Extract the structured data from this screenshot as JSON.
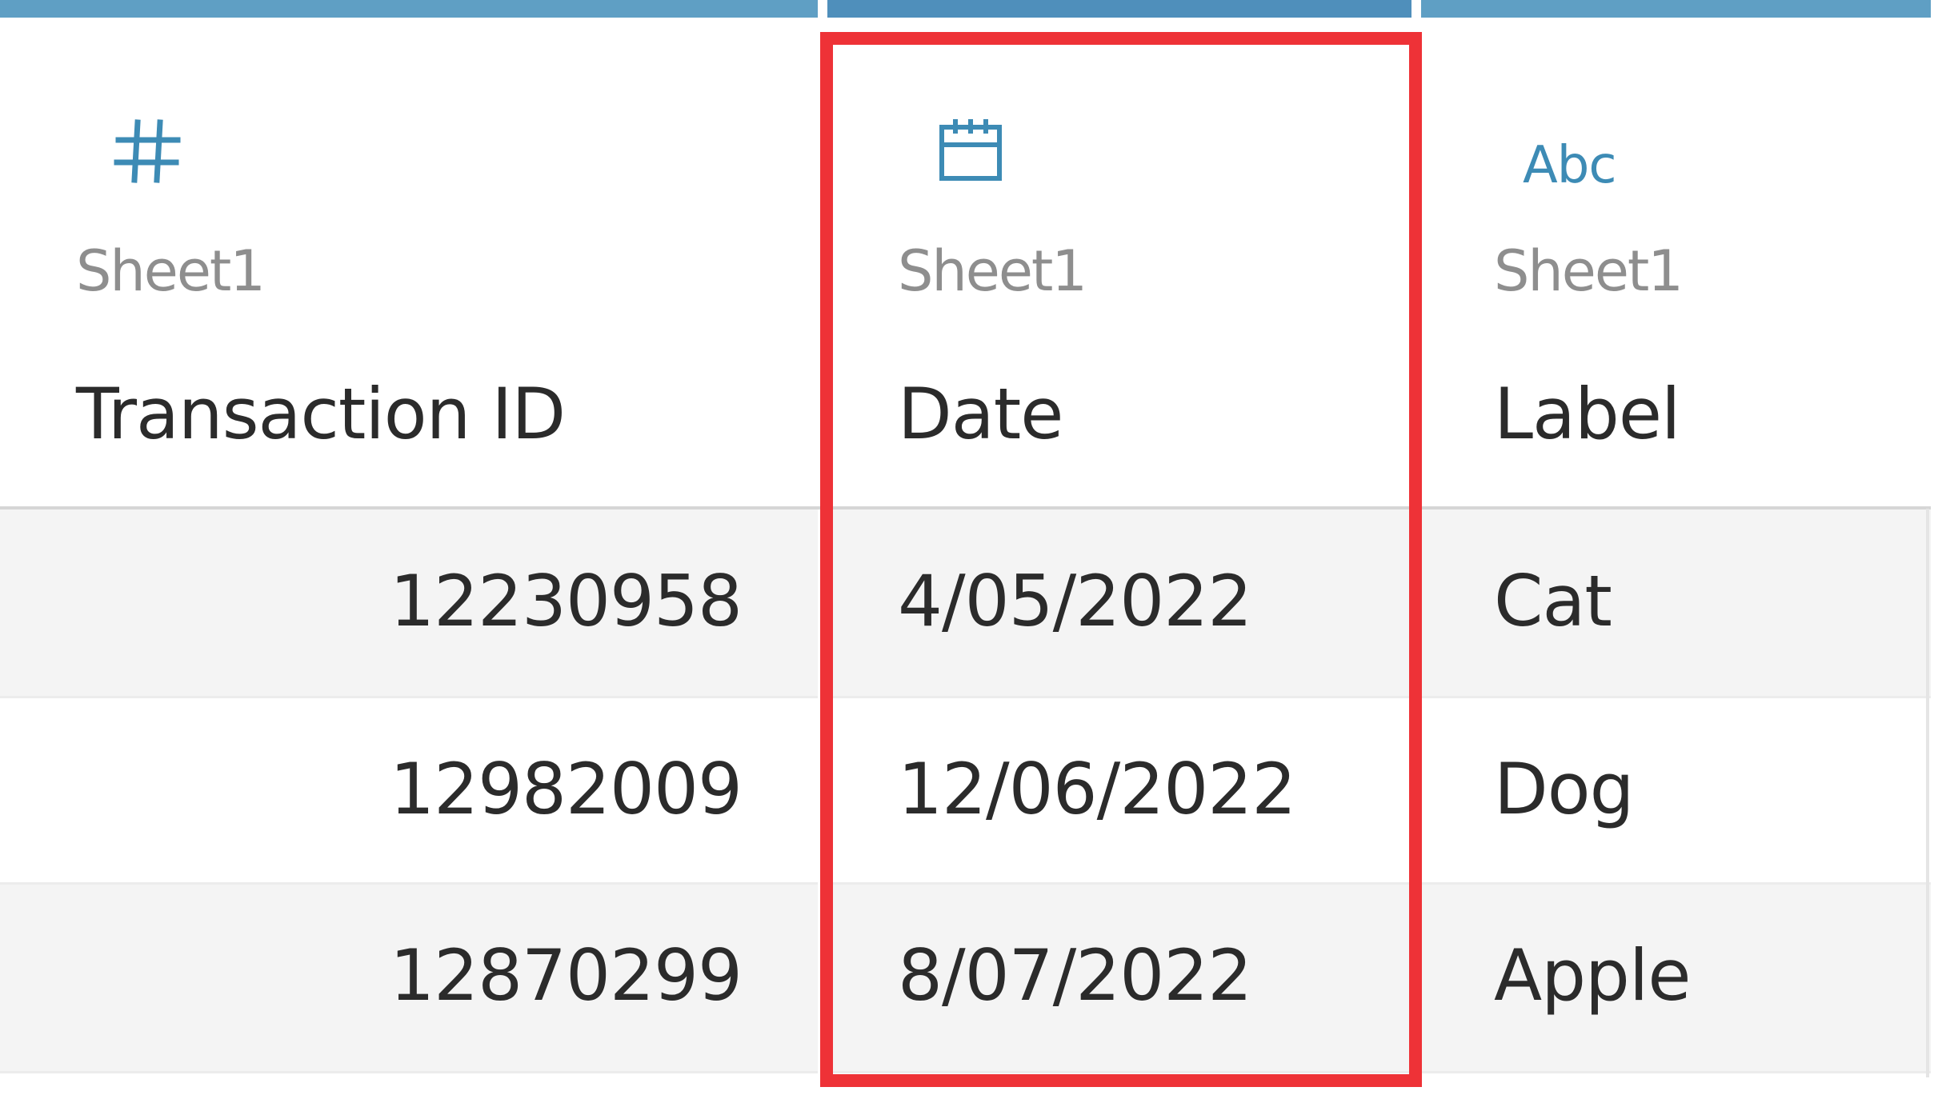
{
  "columns": [
    {
      "type_icon": "number-icon",
      "source": "Sheet1",
      "field": "Transaction ID"
    },
    {
      "type_icon": "calendar-icon",
      "source": "Sheet1",
      "field": "Date"
    },
    {
      "type_icon": "abc-icon",
      "type_icon_text": "Abc",
      "source": "Sheet1",
      "field": "Label"
    }
  ],
  "rows": [
    {
      "transaction_id": "12230958",
      "date": "4/05/2022",
      "label": "Cat"
    },
    {
      "transaction_id": "12982009",
      "date": "12/06/2022",
      "label": "Dog"
    },
    {
      "transaction_id": "12870299",
      "date": "8/07/2022",
      "label": "Apple"
    }
  ],
  "colors": {
    "header_bar": "#5f9fc4",
    "icon": "#3d8bb5",
    "highlight": "#ee3237",
    "row_alt": "#f4f4f4"
  }
}
